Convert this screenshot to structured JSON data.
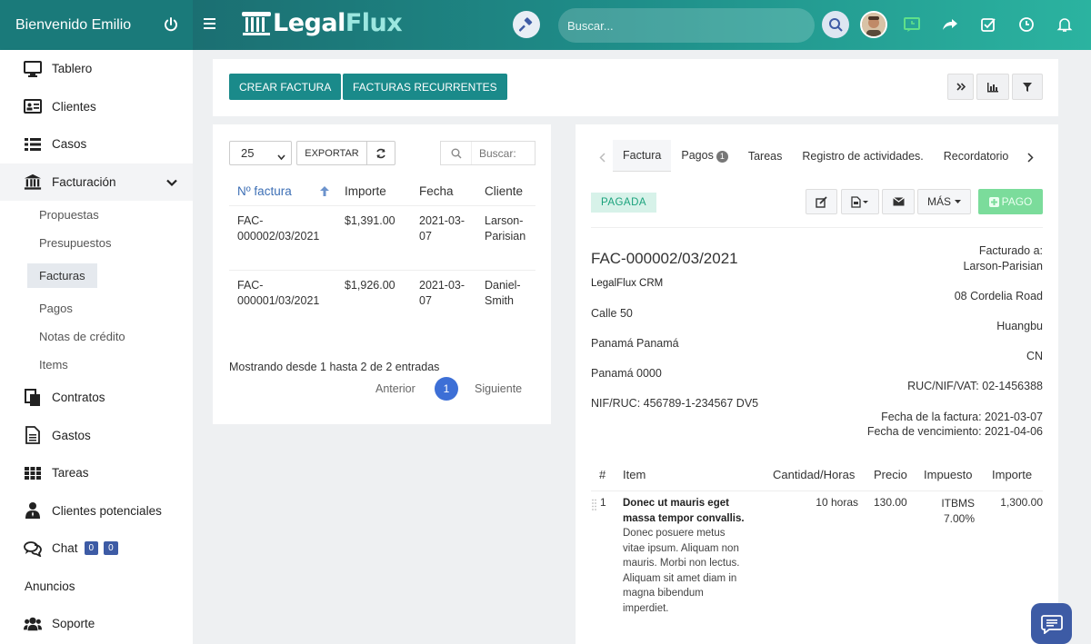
{
  "header": {
    "welcome": "Bienvenido Emilio",
    "logo_a": "Legal",
    "logo_b": "Flux",
    "search_placeholder": "Buscar..."
  },
  "sidebar": {
    "items": [
      {
        "label": "Tablero"
      },
      {
        "label": "Clientes"
      },
      {
        "label": "Casos"
      },
      {
        "label": "Facturación"
      },
      {
        "label": "Contratos"
      },
      {
        "label": "Gastos"
      },
      {
        "label": "Tareas"
      },
      {
        "label": "Clientes potenciales"
      },
      {
        "label": "Chat"
      },
      {
        "label": "Anuncios"
      },
      {
        "label": "Soporte"
      }
    ],
    "billing_sub": [
      "Propuestas",
      "Presupuestos",
      "Facturas",
      "Pagos",
      "Notas de crédito",
      "Items"
    ],
    "chat_badges": [
      "0",
      "0"
    ]
  },
  "toolbar": {
    "create_invoice": "CREAR FACTURA",
    "recurring_invoices": "FACTURAS RECURRENTES"
  },
  "list": {
    "page_size": "25",
    "export": "EXPORTAR",
    "search_placeholder": "Buscar:",
    "columns": [
      "Nº factura",
      "Importe",
      "Fecha",
      "Cliente"
    ],
    "rows": [
      {
        "number_a": "FAC-",
        "number_b": "000002/03/2021",
        "amount": "$1,391.00",
        "date_a": "2021-03-",
        "date_b": "07",
        "client_a": "Larson-",
        "client_b": "Parisian"
      },
      {
        "number_a": "FAC-",
        "number_b": "000001/03/2021",
        "amount": "$1,926.00",
        "date_a": "2021-03-",
        "date_b": "07",
        "client_a": "Daniel-",
        "client_b": "Smith"
      }
    ],
    "showing": "Mostrando desde 1 hasta 2 de 2 entradas",
    "prev": "Anterior",
    "page": "1",
    "next": "Siguiente"
  },
  "detail": {
    "tabs": [
      "Factura",
      "Pagos",
      "Tareas",
      "Registro de actividades.",
      "Recordatorio"
    ],
    "payments_badge": "1",
    "status": "PAGADA",
    "more": "MÁS",
    "pay": "PAGO",
    "invoice_number": "FAC-000002/03/2021",
    "company": "LegalFlux CRM",
    "from_lines": [
      "Calle 50",
      "Panamá Panamá",
      "Panamá 0000",
      "NIF/RUC: 456789-1-234567 DV5"
    ],
    "billed_to_label": "Facturado a:",
    "billed_to": "Larson-Parisian",
    "to_lines": [
      "08 Cordelia Road",
      "Huangbu",
      "CN",
      "RUC/NIF/VAT: 02-1456388"
    ],
    "invoice_date": "Fecha de la factura: 2021-03-07",
    "due_date": "Fecha de vencimiento: 2021-04-06",
    "items_columns": [
      "#",
      "Item",
      "Cantidad/Horas",
      "Precio",
      "Impuesto",
      "Importe"
    ],
    "items": [
      {
        "num": "1",
        "title_lines": [
          "Donec ut mauris eget",
          "massa tempor convallis."
        ],
        "desc_lines": [
          "Donec posuere metus",
          "vitae ipsum. Aliquam non",
          "mauris. Morbi non lectus.",
          "Aliquam sit amet diam in",
          "magna bibendum",
          "imperdiet."
        ],
        "qty": "10 horas",
        "price": "130.00",
        "tax_a": "ITBMS",
        "tax_b": "7.00%",
        "amount": "1,300.00"
      }
    ]
  },
  "colors": {
    "teal": "#1a8a8a",
    "header_start": "#1b6f72",
    "header_end": "#2bb3a0",
    "paid_bg": "#d7f2e9",
    "paid_text": "#1aa27c",
    "accent_blue": "#3d5ba5"
  }
}
